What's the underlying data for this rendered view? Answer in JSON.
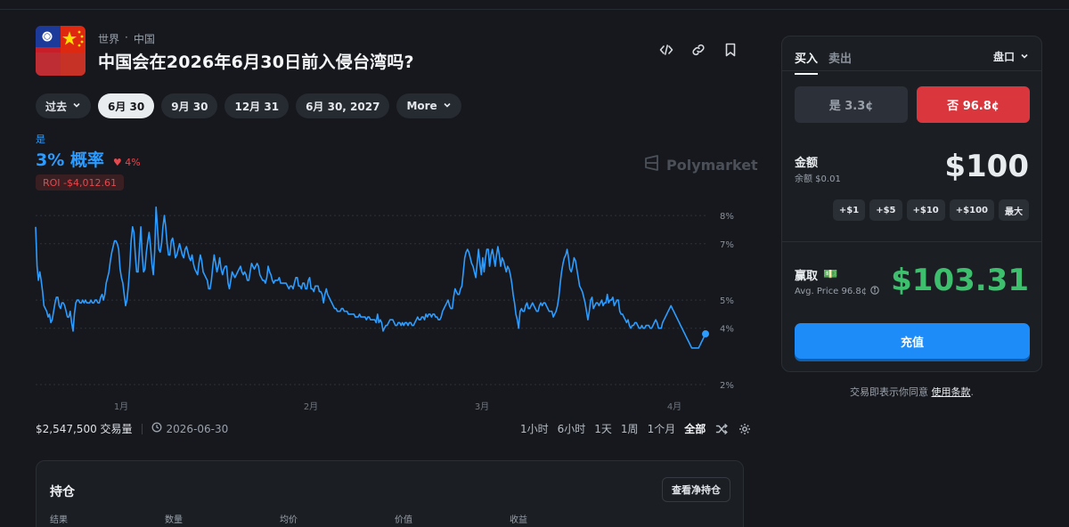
{
  "market": {
    "breadcrumb": [
      "世界",
      "中国"
    ],
    "breadcrumb_sep": "·",
    "title": "中国会在2026年6月30日前入侵台湾吗?"
  },
  "header_icons": [
    "embed-icon",
    "link-icon",
    "bookmark-icon"
  ],
  "date_pills": [
    {
      "label": "过去",
      "dropdown": true,
      "active": false
    },
    {
      "label": "6月 30",
      "active": true
    },
    {
      "label": "9月 30",
      "active": false
    },
    {
      "label": "12月 31",
      "active": false
    },
    {
      "label": "6月 30, 2027",
      "active": false
    },
    {
      "label": "More",
      "dropdown": true,
      "active": false
    }
  ],
  "probability": {
    "outcome_label": "是",
    "value_text": "3% 概率",
    "delta_text": "4%",
    "roi_text": "ROI -$4,012.61"
  },
  "watermark": "Polymarket",
  "chart_data": {
    "type": "line",
    "x_ticks": [
      "1月",
      "2月",
      "3月",
      "4月"
    ],
    "y_ticks": [
      "2%",
      "4%",
      "5%",
      "7%",
      "8%"
    ],
    "ylim": [
      2,
      8.7
    ],
    "grid": "horizontal-dotted",
    "series": [
      {
        "color": "#2d9cff",
        "values": [
          7.6,
          6.2,
          5.7,
          6.0,
          5.7,
          5.3,
          4.8,
          4.7,
          4.6,
          4.4,
          4.5,
          4.2,
          4.3,
          4.6,
          4.9,
          5.1,
          5.1,
          4.8,
          4.7,
          4.9,
          4.9,
          4.8,
          4.6,
          4.4,
          4.4,
          4.6,
          4.2,
          3.9,
          4.5,
          4.9,
          5.0,
          5.0,
          4.9,
          4.9,
          5.0,
          4.9,
          5.0,
          4.9,
          4.9,
          4.9,
          5.0,
          4.9,
          4.9,
          5.0,
          5.0,
          4.9,
          4.9,
          5.1,
          5.2,
          5.0,
          5.2,
          5.6,
          5.8,
          6.0,
          6.4,
          6.7,
          6.9,
          7.1,
          7.1,
          7.0,
          6.8,
          6.1,
          5.8,
          5.6,
          5.2,
          4.8,
          5.0,
          5.5,
          6.2,
          7.1,
          7.6,
          7.4,
          6.6,
          6.0,
          6.0,
          6.8,
          7.6,
          6.6,
          6.0,
          6.1,
          6.7,
          7.1,
          7.4,
          6.9,
          6.3,
          5.9,
          6.7,
          8.3,
          7.6,
          6.8,
          6.7,
          7.0,
          7.6,
          8.0,
          7.6,
          7.0,
          6.6,
          6.6,
          7.1,
          7.2,
          6.9,
          6.5,
          6.6,
          6.8,
          7.0,
          6.8,
          6.6,
          6.5,
          6.8,
          6.9,
          6.7,
          6.5,
          6.4,
          6.6,
          6.3,
          6.1,
          6.0,
          5.9,
          6.3,
          6.6,
          6.4,
          6.0,
          5.9,
          5.8,
          5.7,
          5.4,
          5.4,
          5.7,
          6.2,
          6.6,
          6.3,
          6.0,
          6.2,
          6.5,
          6.1,
          5.9,
          6.1,
          6.2,
          6.2,
          5.6,
          5.4,
          5.7,
          6.0,
          5.9,
          5.8,
          5.9,
          6.0,
          6.1,
          6.2,
          6.0,
          5.9,
          6.0,
          5.9,
          5.7,
          5.7,
          6.0,
          6.3,
          6.2,
          6.1,
          6.2,
          6.3,
          6.2,
          5.9,
          5.8,
          5.7,
          5.7,
          5.6,
          5.8,
          6.2,
          6.0,
          5.9,
          5.7,
          5.6,
          5.7,
          5.7,
          5.7,
          5.8,
          5.6,
          5.6,
          5.6,
          5.6,
          5.6,
          5.5,
          5.4,
          5.5,
          5.5,
          5.4,
          5.6,
          5.8,
          5.8,
          5.5,
          5.5,
          5.4,
          5.6,
          5.6,
          5.4,
          5.4,
          5.7,
          5.8,
          5.4,
          5.4,
          5.3,
          5.5,
          5.5,
          5.5,
          5.3,
          5.3,
          5.2,
          4.9,
          5.2,
          5.4,
          5.2,
          5.1,
          5.0,
          4.9,
          4.8,
          4.7,
          4.7,
          4.6,
          4.6,
          4.6,
          4.7,
          4.7,
          4.6,
          4.6,
          4.6,
          4.5,
          4.5,
          4.5,
          4.5,
          4.5,
          4.4,
          4.4,
          4.4,
          4.5,
          4.4,
          4.4,
          4.4,
          4.4,
          4.3,
          4.4,
          4.4,
          4.3,
          4.3,
          4.3,
          4.3,
          4.2,
          4.5,
          4.2,
          4.3,
          4.2,
          3.9,
          4.0,
          4.1,
          4.1,
          4.2,
          4.3,
          4.3,
          4.3,
          4.2,
          4.1,
          4.1,
          4.2,
          4.2,
          4.1,
          4.2,
          4.1,
          4.2,
          4.2,
          4.1,
          4.2,
          4.2,
          4.1,
          4.1,
          4.2,
          4.3,
          4.4,
          4.3,
          4.3,
          4.4,
          4.4,
          4.3,
          4.5,
          4.4,
          4.5,
          4.5,
          4.4,
          4.5,
          4.5,
          4.4,
          4.4,
          4.3,
          4.3,
          4.4,
          4.6,
          4.7,
          4.8,
          4.9,
          5.0,
          4.8,
          4.7,
          4.7,
          5.1,
          5.4,
          5.3,
          5.2,
          5.2,
          5.4,
          5.5,
          6.0,
          6.5,
          6.7,
          6.8,
          6.7,
          6.5,
          6.3,
          6.2,
          6.0,
          5.8,
          6.3,
          6.8,
          6.3,
          5.9,
          6.5,
          6.0,
          6.5,
          6.8,
          6.8,
          6.2,
          6.6,
          6.8,
          6.5,
          6.2,
          6.6,
          6.9,
          6.6,
          6.2,
          6.5,
          6.4,
          6.2,
          6.0,
          6.2,
          6.1,
          5.9,
          5.6,
          5.2,
          4.9,
          4.5,
          4.3,
          4.0,
          4.6,
          4.7,
          4.6,
          4.6,
          4.8,
          4.9,
          4.7,
          4.7,
          4.8,
          4.9,
          4.8,
          4.7,
          4.6,
          4.6,
          4.8,
          4.9,
          4.8,
          4.9,
          4.9,
          4.8,
          4.7,
          4.6,
          4.6,
          4.6,
          4.4,
          4.5,
          4.6,
          4.8,
          5.1,
          5.6,
          6.0,
          6.3,
          6.5,
          6.6,
          6.8,
          6.5,
          6.1,
          6.0,
          6.2,
          6.5,
          6.4,
          6.1,
          5.8,
          5.5,
          5.4,
          5.3,
          5.1,
          4.9,
          4.6,
          4.3,
          4.6,
          5.0,
          5.1,
          4.7,
          4.8,
          4.9,
          4.9,
          4.8,
          4.9,
          5.0,
          4.8,
          4.9,
          4.9,
          5.2,
          4.9,
          5.0,
          5.0,
          5.1,
          4.8,
          4.9,
          5.0,
          5.0,
          4.6,
          4.5,
          4.5,
          4.4,
          4.3,
          4.2,
          4.3,
          4.1,
          4.0,
          4.1,
          4.1,
          4.2,
          4.2,
          4.1,
          4.0,
          4.0,
          4.1,
          4.0,
          4.0,
          4.1,
          4.1,
          4.1,
          4.0,
          4.0,
          4.1,
          4.2,
          4.3,
          4.2,
          4.0,
          4.0,
          4.0,
          4.2,
          4.3,
          4.4,
          4.5,
          4.6,
          4.7,
          4.8,
          4.7,
          4.6,
          4.5,
          4.4,
          4.3,
          4.2,
          4.1,
          4.0,
          3.9,
          3.8,
          3.7,
          3.6,
          3.5,
          3.4,
          3.3,
          3.3,
          3.3,
          3.3,
          3.3,
          3.3,
          3.4,
          3.5,
          3.6,
          3.7,
          3.8
        ]
      }
    ]
  },
  "chart_footer": {
    "volume": "$2,547,500 交易量",
    "end_date": "2026-06-30",
    "ranges": [
      "1小时",
      "6小时",
      "1天",
      "1周",
      "1个月",
      "全部"
    ],
    "active_range": "全部"
  },
  "positions": {
    "title": "持仓",
    "button": "查看净持仓",
    "columns": [
      "结果",
      "数量",
      "均价",
      "价值",
      "收益"
    ]
  },
  "trade": {
    "tab_buy": "买入",
    "tab_sell": "卖出",
    "order_type": "盘口",
    "yes_button": "是 3.3¢",
    "no_button": "否 96.8¢",
    "amount_label": "金额",
    "balance": "余额 $0.01",
    "amount": "$100",
    "quick_add": [
      "+$1",
      "+$5",
      "+$10",
      "+$100",
      "最大"
    ],
    "win_label": "赢取",
    "win_emoji": "💵",
    "avg_price": "Avg. Price 96.8¢",
    "win_amount": "$103.31",
    "deposit": "充值",
    "terms_text": "交易即表示你同意",
    "terms_link": "使用条款",
    "terms_end": "."
  },
  "colors": {
    "background": "#16181d",
    "accent_blue": "#2d9cff",
    "no_red": "#d9363e",
    "win_green": "#3dbf6e"
  }
}
